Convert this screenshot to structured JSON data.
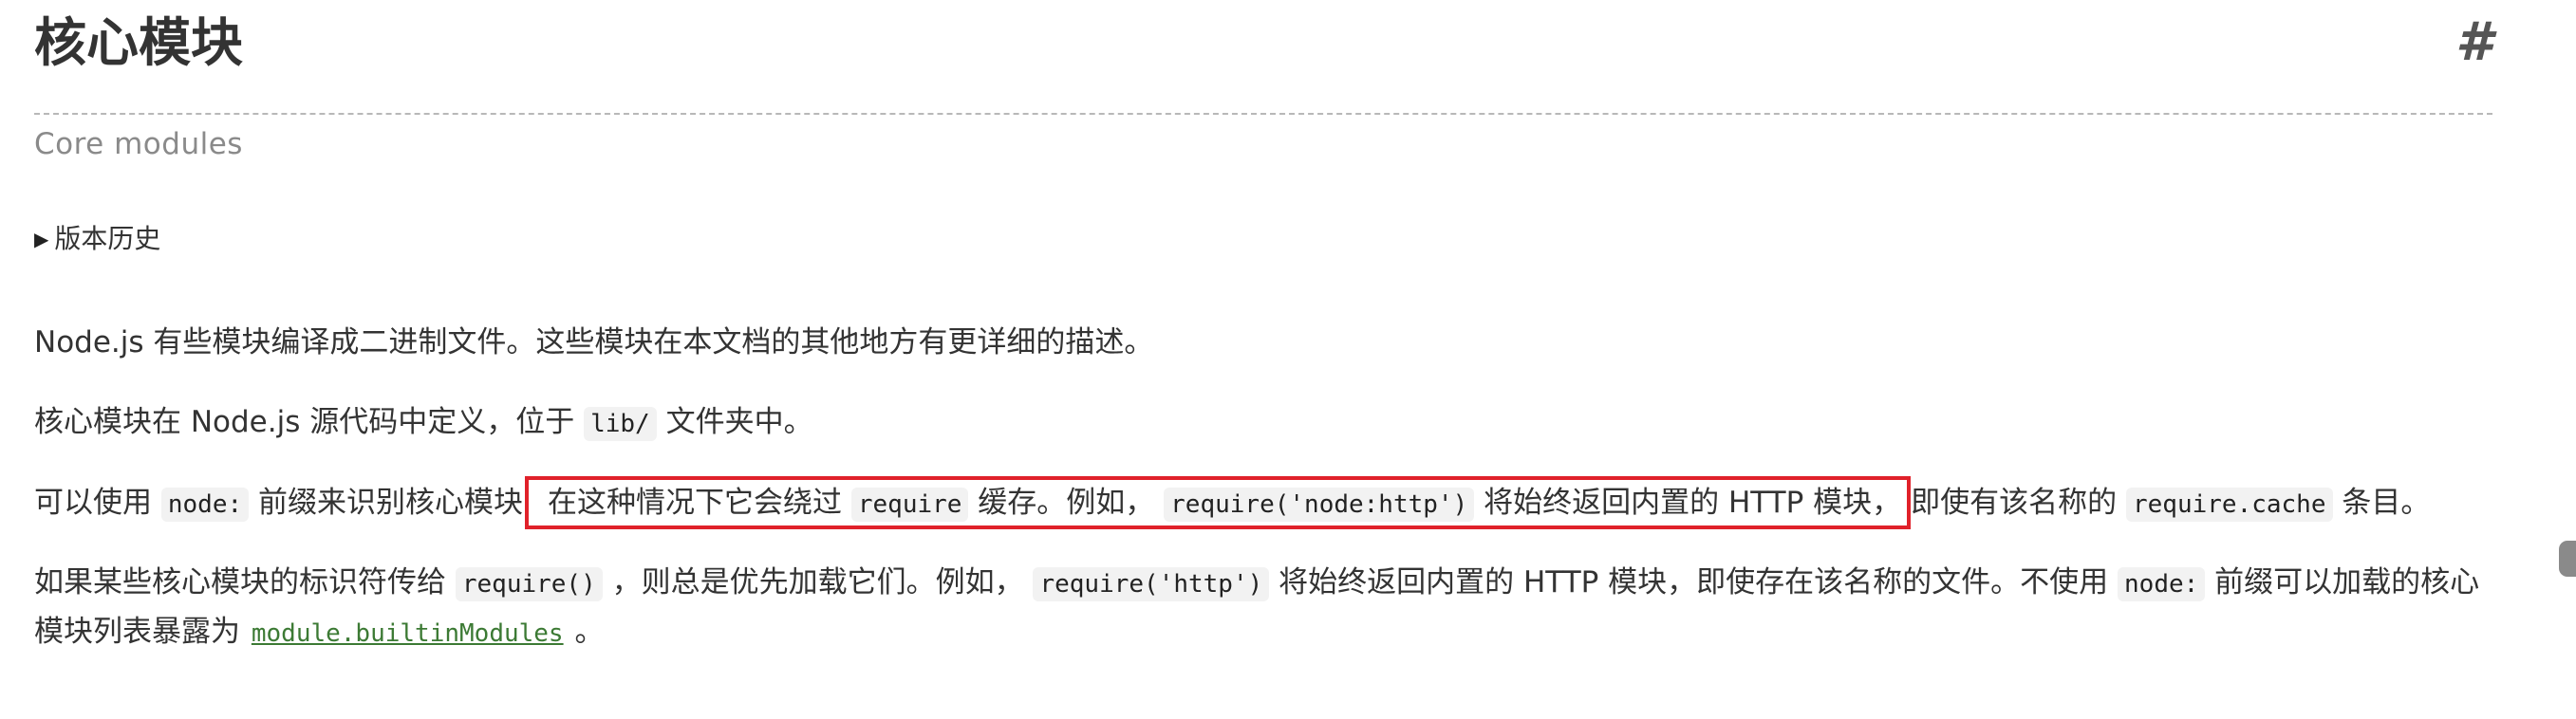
{
  "heading": {
    "title": "核心模块",
    "anchor": "#"
  },
  "subtitle": "Core modules",
  "history": {
    "triangle": "▶",
    "label": "版本历史"
  },
  "p1": "Node.js 有些模块编译成二进制文件。这些模块在本文档的其他地方有更详细的描述。",
  "p2": {
    "a": "核心模块在 Node.js 源代码中定义，位于 ",
    "code": "lib/",
    "b": " 文件夹中。"
  },
  "p3": {
    "a": "可以使用 ",
    "code1": "node:",
    "b": " 前缀来识别核心模块",
    "highlight_a": "在这种情况下它会绕过 ",
    "code2": "require",
    "highlight_b": " 缓存。例如， ",
    "code3": "require('node:http')",
    "highlight_c": " 将始终返回内置的 HTTP 模块，",
    "c": "即使有该名称的 ",
    "code4": "require.cache",
    "d": " 条目。"
  },
  "p4": {
    "a": "如果某些核心模块的标识符传给 ",
    "code1": "require()",
    "b": " ，则总是优先加载它们。例如， ",
    "code2": "require('http')",
    "c": " 将始终返回内置的 HTTP 模块，即使存在该名称的文件。不使用 ",
    "code3": "node:",
    "d": " 前缀可以加载的核心模块列表暴露为 ",
    "link": "module.builtinModules",
    "e": " 。"
  },
  "colors": {
    "highlight_border": "#e0212a",
    "link": "#3c7a34",
    "subtitle": "#8a8a8a",
    "text": "#333333"
  }
}
